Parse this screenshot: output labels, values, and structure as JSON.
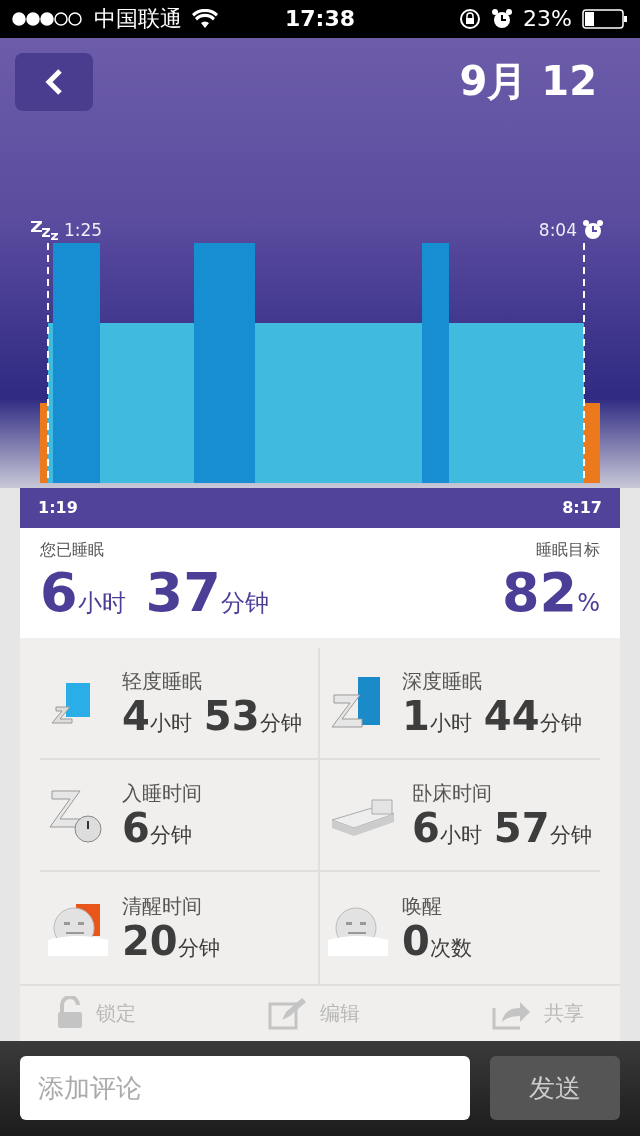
{
  "status_bar": {
    "carrier": "中国联通",
    "time": "17:38",
    "battery": "23%"
  },
  "header": {
    "date": "9月 12"
  },
  "chart": {
    "sleep_start": "1:25",
    "wake_time": "8:04",
    "start": "1:19",
    "end": "8:17"
  },
  "summary": {
    "slept": {
      "label": "您已睡眠",
      "hours": "6",
      "hours_unit": "小时",
      "minutes": "37",
      "minutes_unit": "分钟"
    },
    "goal": {
      "label": "睡眠目标",
      "value": "82",
      "unit": "%"
    }
  },
  "stats": [
    {
      "kind": "light",
      "label": "轻度睡眠",
      "parts": [
        {
          "value": "4",
          "unit": "小时"
        },
        {
          "value": "53",
          "unit": "分钟"
        }
      ]
    },
    {
      "kind": "deep",
      "label": "深度睡眠",
      "parts": [
        {
          "value": "1",
          "unit": "小时"
        },
        {
          "value": "44",
          "unit": "分钟"
        }
      ]
    },
    {
      "kind": "fall_asleep",
      "label": "入睡时间",
      "parts": [
        {
          "value": "6",
          "unit": "分钟"
        }
      ]
    },
    {
      "kind": "in_bed",
      "label": "卧床时间",
      "parts": [
        {
          "value": "6",
          "unit": "小时"
        },
        {
          "value": "57",
          "unit": "分钟"
        }
      ]
    },
    {
      "kind": "awake",
      "label": "清醒时间",
      "parts": [
        {
          "value": "20",
          "unit": "分钟"
        }
      ]
    },
    {
      "kind": "woken",
      "label": "唤醒",
      "parts": [
        {
          "value": "0",
          "unit": "次数"
        }
      ]
    }
  ],
  "actions": [
    {
      "kind": "lock",
      "label": "锁定"
    },
    {
      "kind": "edit",
      "label": "编辑"
    },
    {
      "kind": "share",
      "label": "共享"
    }
  ],
  "comment": {
    "placeholder": "添加评论",
    "send": "发送"
  }
}
